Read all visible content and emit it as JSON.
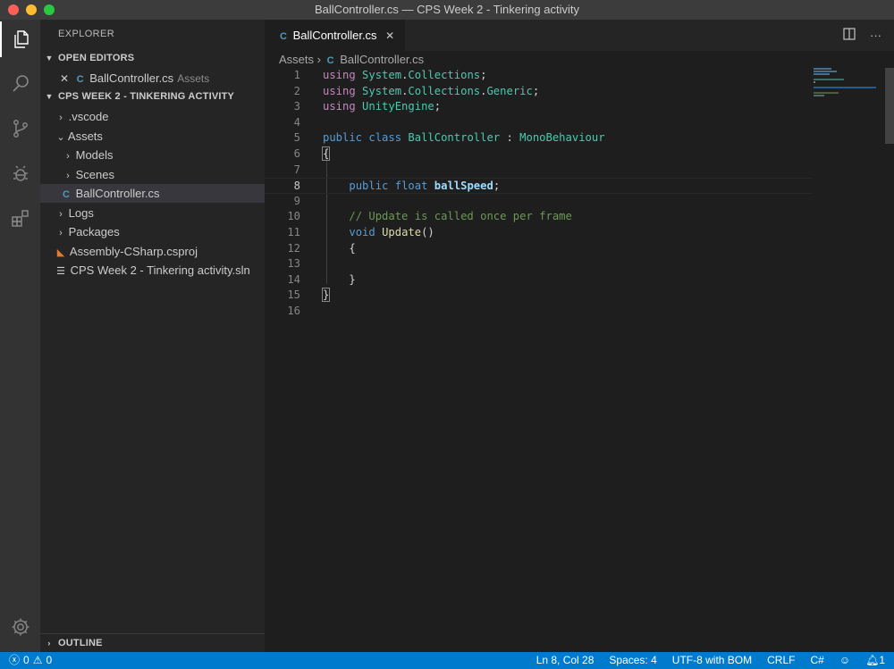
{
  "window": {
    "title": "BallController.cs — CPS Week 2 - Tinkering activity"
  },
  "activity_bar": {
    "items": [
      {
        "name": "explorer",
        "icon": "files-icon"
      },
      {
        "name": "search",
        "icon": "search-icon"
      },
      {
        "name": "source-control",
        "icon": "source-control-icon"
      },
      {
        "name": "debug",
        "icon": "debug-icon"
      },
      {
        "name": "extensions",
        "icon": "extensions-icon"
      }
    ],
    "bottom_icon": "gear-icon"
  },
  "sidebar": {
    "title": "EXPLORER",
    "open_editors": {
      "heading": "OPEN EDITORS",
      "items": [
        {
          "name": "BallController.cs",
          "folder": "Assets"
        }
      ]
    },
    "project": {
      "heading": "CPS WEEK 2 - TINKERING ACTIVITY",
      "tree": [
        {
          "label": ".vscode",
          "type": "folder",
          "expanded": false
        },
        {
          "label": "Assets",
          "type": "folder",
          "expanded": true
        },
        {
          "label": "Models",
          "type": "folder",
          "expanded": false
        },
        {
          "label": "Scenes",
          "type": "folder",
          "expanded": false
        },
        {
          "label": "BallController.cs",
          "type": "file-cs",
          "selected": true
        },
        {
          "label": "Logs",
          "type": "folder",
          "expanded": false
        },
        {
          "label": "Packages",
          "type": "folder",
          "expanded": false
        },
        {
          "label": "Assembly-CSharp.csproj",
          "type": "file-csproj"
        },
        {
          "label": "CPS Week 2 - Tinkering activity.sln",
          "type": "file-sln"
        }
      ]
    },
    "outline": {
      "heading": "OUTLINE"
    }
  },
  "editor": {
    "tab": {
      "label": "BallController.cs"
    },
    "breadcrumb": {
      "folder": "Assets",
      "file": "BallController.cs"
    },
    "current_line": 8,
    "line_numbers": [
      "1",
      "2",
      "3",
      "4",
      "5",
      "6",
      "7",
      "8",
      "9",
      "10",
      "11",
      "12",
      "13",
      "14",
      "15",
      "16"
    ],
    "code": {
      "l1": {
        "kw": "using",
        "ns1": "System",
        "dot": ".",
        "ns2": "Collections",
        "end": ";"
      },
      "l2": {
        "kw": "using",
        "ns1": "System",
        "dot1": ".",
        "ns2": "Collections",
        "dot2": ".",
        "ns3": "Generic",
        "end": ";"
      },
      "l3": {
        "kw": "using",
        "ns1": "UnityEngine",
        "end": ";"
      },
      "l5": {
        "mod": "public",
        "kw": "class",
        "name": "BallController",
        "colon": " : ",
        "base": "MonoBehaviour"
      },
      "l6": {
        "text": "{"
      },
      "l8": {
        "mod": "public",
        "type": "float",
        "var": "ballSpeed",
        "end": ";"
      },
      "l10": {
        "comment": "// Update is called once per frame"
      },
      "l11": {
        "type": "void",
        "fn": "Update",
        "end": "()"
      },
      "l12": {
        "text": "{"
      },
      "l14": {
        "text": "}"
      },
      "l15": {
        "text": "}"
      }
    }
  },
  "status_bar": {
    "errors": "0",
    "warnings": "0",
    "position": "Ln 8, Col 28",
    "spaces": "Spaces: 4",
    "encoding": "UTF-8 with BOM",
    "eol": "CRLF",
    "language": "C#",
    "notifications": "1"
  }
}
